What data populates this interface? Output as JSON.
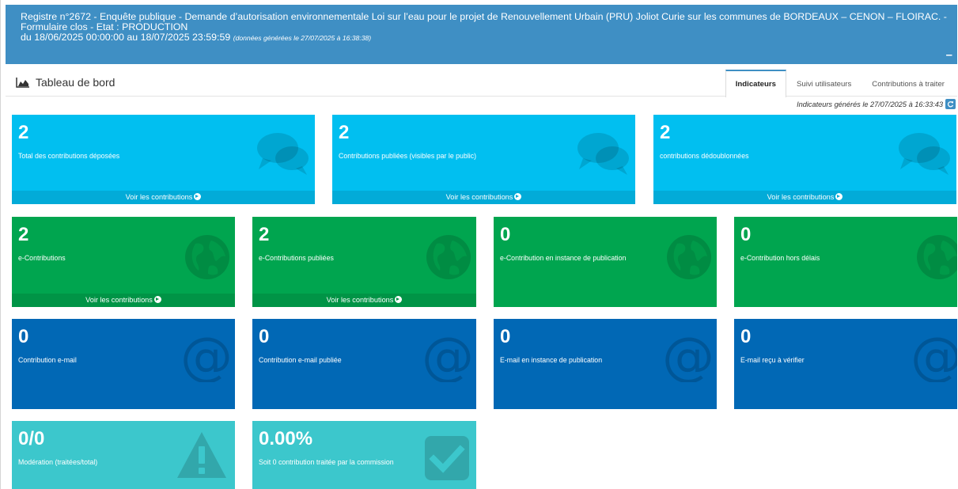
{
  "header": {
    "line1": "Registre n°2672 - Enquête publique - Demande d’autorisation environnementale Loi sur l’eau pour le projet de Renouvellement Urbain (PRU) Joliot Curie sur les communes de BORDEAUX – CENON – FLOIRAC. -",
    "line2": "Formulaire clos - Etat : PRODUCTION",
    "period": "du 18/06/2025 00:00:00 au 18/07/2025 23:59:59",
    "generated_note": "(données générées le 27/07/2025 à 16:38:38)",
    "collapse_label": "–"
  },
  "dashboard": {
    "title": "Tableau de bord",
    "icon": "area-chart-icon",
    "tabs": [
      {
        "label": "Indicateurs",
        "active": true
      },
      {
        "label": "Suivi utilisateurs",
        "active": false
      },
      {
        "label": "Contributions à traiter",
        "active": false
      }
    ],
    "generated_line": "Indicateurs générés le 27/07/2025 à 16:33:43"
  },
  "tiles": {
    "total": {
      "value": "2",
      "label": "Total des contributions déposées",
      "footer": "Voir les contributions",
      "icon": "comments-icon"
    },
    "published": {
      "value": "2",
      "label": "Contributions publiées (visibles par le public)",
      "footer": "Voir les contributions",
      "icon": "comments-icon"
    },
    "deduplicated": {
      "value": "2",
      "label": "contributions dédoublonnées",
      "footer": "Voir les contributions",
      "icon": "comments-icon"
    },
    "econtrib": {
      "value": "2",
      "label": "e-Contributions",
      "footer": "Voir les contributions",
      "icon": "globe-icon"
    },
    "econtrib_published": {
      "value": "2",
      "label": "e-Contributions publiées",
      "footer": "Voir les contributions",
      "icon": "globe-icon"
    },
    "econtrib_pending": {
      "value": "0",
      "label": "e-Contribution en instance de publication",
      "icon": "globe-icon"
    },
    "econtrib_late": {
      "value": "0",
      "label": "e-Contribution hors délais",
      "icon": "globe-icon"
    },
    "email": {
      "value": "0",
      "label": "Contribution e-mail",
      "icon": "at-icon"
    },
    "email_published": {
      "value": "0",
      "label": "Contribution e-mail publiée",
      "icon": "at-icon"
    },
    "email_pending": {
      "value": "0",
      "label": "E-mail en instance de publication",
      "icon": "at-icon"
    },
    "email_to_check": {
      "value": "0",
      "label": "E-mail reçu à vérifier",
      "icon": "at-icon"
    },
    "moderation": {
      "value": "0/0",
      "label": "Modération (traitées/total)",
      "icon": "warning-icon"
    },
    "commission": {
      "value": "0.00%",
      "label": "Soit 0 contribution traitée par la commission",
      "icon": "check-square-icon"
    }
  },
  "colors": {
    "header": "#3f8fc4",
    "cyan_tile": "#01bff0",
    "green_tile": "#00a54f",
    "blue_tile": "#0168b5",
    "teal_tile": "#3cc7cc"
  }
}
